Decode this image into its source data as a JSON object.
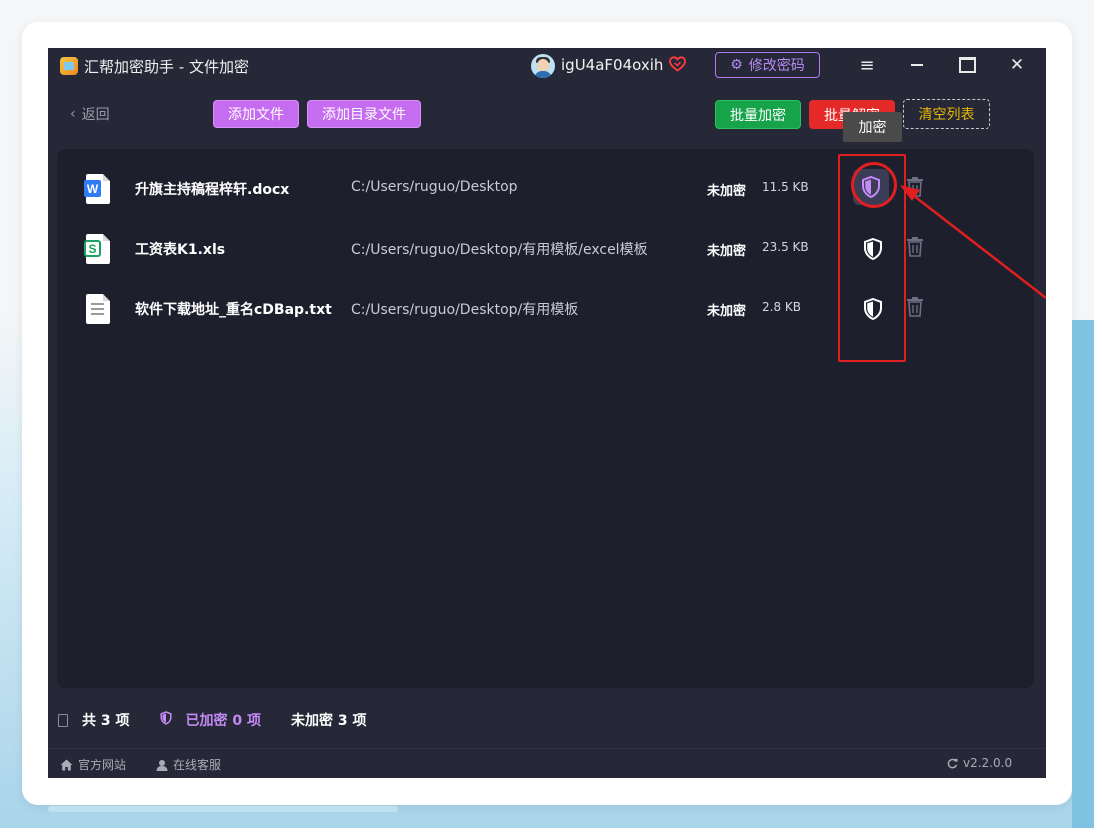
{
  "window": {
    "title": "汇帮加密助手 - 文件加密",
    "username": "igU4aF04oxih",
    "change_password": "修改密码",
    "menu_icon": "≡",
    "close_icon": "✕"
  },
  "toolbar": {
    "back_arrow": "‹",
    "back": "返回",
    "add_file": "添加文件",
    "add_dir": "添加目录文件",
    "batch_encrypt": "批量加密",
    "batch_decrypt": "批量解密",
    "clear_list": "清空列表"
  },
  "tooltip": "加密",
  "files": [
    {
      "name": "升旗主持稿程梓轩.docx",
      "path": "C:/Users/ruguo/Desktop",
      "status": "未加密",
      "size": "11.5 KB",
      "type_icon": "word-icon",
      "badge": "W"
    },
    {
      "name": "工资表K1.xls",
      "path": "C:/Users/ruguo/Desktop/有用模板/excel模板",
      "status": "未加密",
      "size": "23.5 KB",
      "type_icon": "spreadsheet-icon",
      "badge": "S"
    },
    {
      "name": "软件下载地址_重名cDBap.txt",
      "path": "C:/Users/ruguo/Desktop/有用模板",
      "status": "未加密",
      "size": "2.8 KB",
      "type_icon": "text-file-icon",
      "badge": ""
    }
  ],
  "stats": {
    "total": "共 3 项",
    "encrypted": "已加密 0 项",
    "unencrypted": "未加密 3 项"
  },
  "footer": {
    "website": "官方网站",
    "service": "在线客服",
    "version": "v2.2.0.0"
  },
  "colors": {
    "background": "#262838",
    "panel": "#1d1f2c",
    "accent_purple": "#c56cf0",
    "encrypt_green": "#17a34a",
    "decrypt_red": "#e52929",
    "annotation_red": "#e02020"
  }
}
